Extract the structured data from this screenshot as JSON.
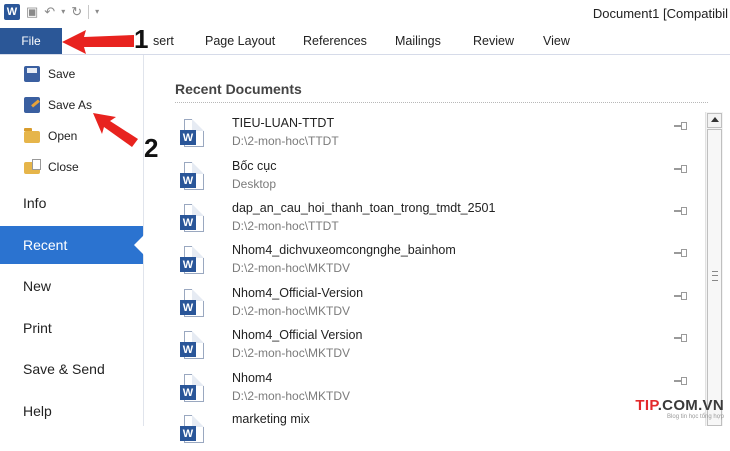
{
  "title_bar": {
    "logo_letter": "W",
    "document_title": "Document1 [Compatibil"
  },
  "ribbon": {
    "file_tab": "File",
    "tabs": [
      "sert",
      "Page Layout",
      "References",
      "Mailings",
      "Review",
      "View"
    ]
  },
  "backstage": {
    "commands": [
      "Save",
      "Save As",
      "Open",
      "Close"
    ],
    "items": [
      "Info",
      "Recent",
      "New",
      "Print",
      "Save & Send",
      "Help"
    ],
    "active_item": "Recent"
  },
  "recent": {
    "heading": "Recent Documents",
    "icon_letter": "W",
    "documents": [
      {
        "name": "TIEU-LUAN-TTDT",
        "path": "D:\\2-mon-hoc\\TTDT"
      },
      {
        "name": "Bốc cục",
        "path": "Desktop"
      },
      {
        "name": "dap_an_cau_hoi_thanh_toan_trong_tmdt_2501",
        "path": "D:\\2-mon-hoc\\TTDT"
      },
      {
        "name": "Nhom4_dichvuxeomcongnghe_bainhom",
        "path": "D:\\2-mon-hoc\\MKTDV"
      },
      {
        "name": "Nhom4_Official-Version",
        "path": "D:\\2-mon-hoc\\MKTDV"
      },
      {
        "name": "Nhom4_Official Version",
        "path": "D:\\2-mon-hoc\\MKTDV"
      },
      {
        "name": "Nhom4",
        "path": "D:\\2-mon-hoc\\MKTDV"
      },
      {
        "name": "marketing mix",
        "path": ""
      }
    ]
  },
  "annotations": {
    "step1": "1",
    "step2": "2",
    "arrow_color": "#e8231f"
  },
  "watermark": {
    "brand_red": "TIP",
    "brand_dark": ".COM.VN",
    "tagline": "Blog tin học tổng hợp"
  }
}
